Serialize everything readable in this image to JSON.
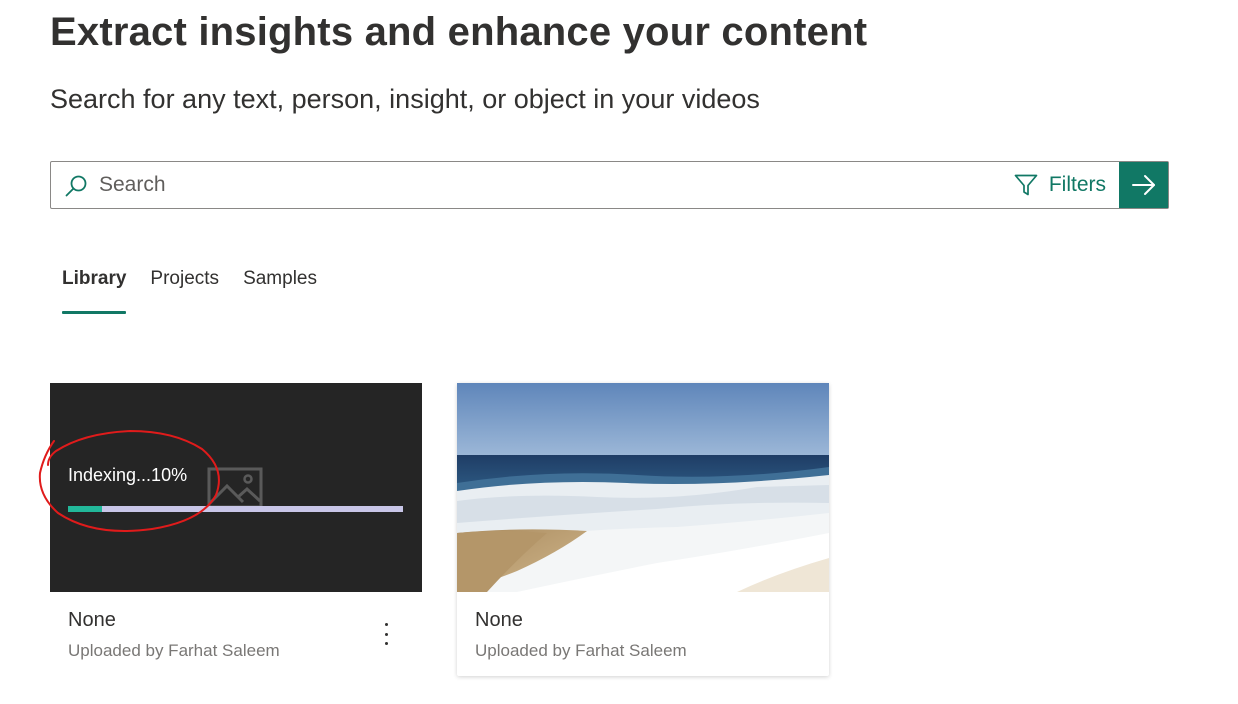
{
  "header": {
    "title": "Extract insights and enhance your content",
    "subtitle": "Search for any text, person, insight, or object in your videos"
  },
  "search": {
    "placeholder": "Search",
    "value": "",
    "filters_label": "Filters",
    "search_icon": "search-icon",
    "filter_icon": "filter-icon",
    "submit_icon": "arrow-right-icon"
  },
  "tabs": [
    {
      "label": "Library",
      "active": true
    },
    {
      "label": "Projects",
      "active": false
    },
    {
      "label": "Samples",
      "active": false
    }
  ],
  "videos": [
    {
      "title": "None",
      "uploaded_by": "Uploaded by Farhat Saleem",
      "status": "Indexing...10%",
      "progress": 0.1,
      "thumbnail": "placeholder-image-icon"
    },
    {
      "title": "None",
      "uploaded_by": "Uploaded by Farhat Saleem",
      "thumbnail": "beach-thumbnail"
    }
  ],
  "colors": {
    "accent": "#117865",
    "progress": "#22b89a",
    "progress_track": "#c8c6e8",
    "annotation": "#e01b1b"
  }
}
